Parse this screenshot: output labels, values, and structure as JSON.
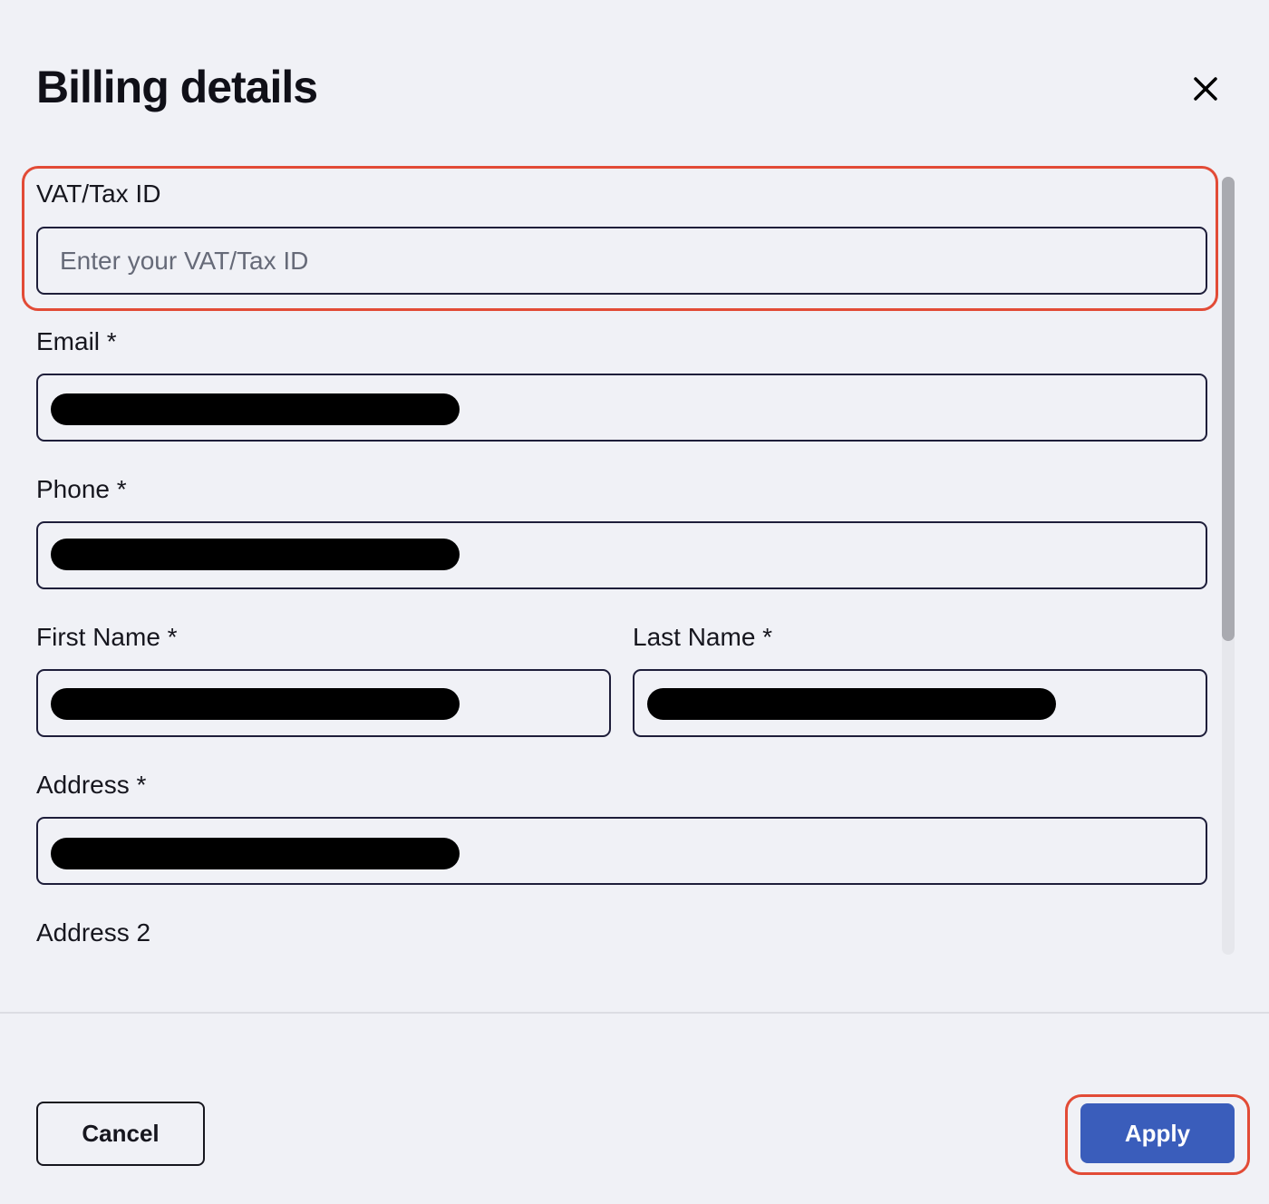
{
  "dialog": {
    "title": "Billing details",
    "close_icon": "close-icon"
  },
  "form": {
    "vat": {
      "label": "VAT/Tax ID",
      "placeholder": "Enter your VAT/Tax ID",
      "value": ""
    },
    "email": {
      "label": "Email *",
      "value_redacted": true
    },
    "phone": {
      "label": "Phone *",
      "value_redacted": true
    },
    "first_name": {
      "label": "First Name *",
      "value_redacted": true
    },
    "last_name": {
      "label": "Last Name *",
      "value_redacted": true
    },
    "address": {
      "label": "Address *",
      "value_redacted": true
    },
    "address2": {
      "label": "Address 2"
    }
  },
  "footer": {
    "cancel_label": "Cancel",
    "apply_label": "Apply"
  },
  "colors": {
    "background": "#f0f1f6",
    "primary": "#3a5dbb",
    "highlight": "#e24b36",
    "border": "#1e1e3a"
  }
}
